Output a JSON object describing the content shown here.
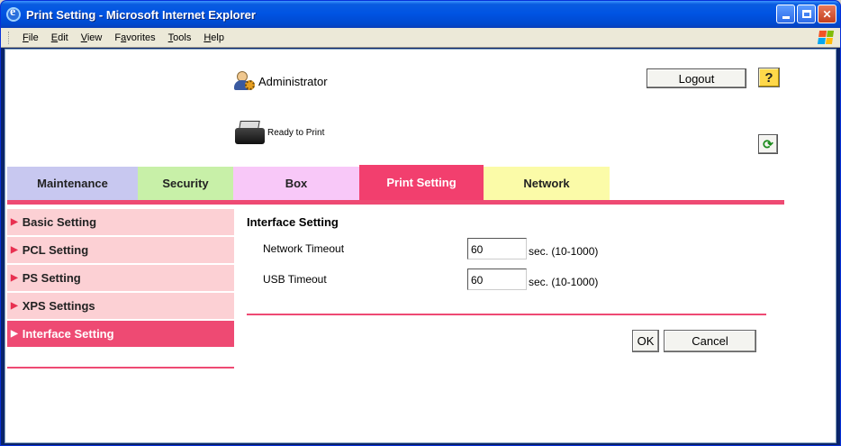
{
  "window": {
    "title": "Print Setting - Microsoft Internet Explorer",
    "menu": [
      {
        "pre": "",
        "ul": "F",
        "post": "ile"
      },
      {
        "pre": "",
        "ul": "E",
        "post": "dit"
      },
      {
        "pre": "",
        "ul": "V",
        "post": "iew"
      },
      {
        "pre": "F",
        "ul": "a",
        "post": "vorites"
      },
      {
        "pre": "",
        "ul": "T",
        "post": "ools"
      },
      {
        "pre": "",
        "ul": "H",
        "post": "elp"
      }
    ]
  },
  "header": {
    "user_label": "Administrator",
    "logout_label": "Logout",
    "help_label": "?",
    "status_label": "Ready to Print"
  },
  "tabs": [
    {
      "label": "Maintenance"
    },
    {
      "label": "Security"
    },
    {
      "label": "Box"
    },
    {
      "label": "Print Setting"
    },
    {
      "label": "Network"
    }
  ],
  "sidebar": {
    "items": [
      {
        "label": "Basic Setting"
      },
      {
        "label": "PCL Setting"
      },
      {
        "label": "PS Setting"
      },
      {
        "label": "XPS Settings"
      },
      {
        "label": "Interface Setting"
      }
    ]
  },
  "main": {
    "title": "Interface Setting",
    "fields": [
      {
        "label": "Network Timeout",
        "value": "60",
        "unit": "sec. (10-1000)"
      },
      {
        "label": "USB Timeout",
        "value": "60",
        "unit": "sec. (10-1000)"
      }
    ],
    "ok_label": "OK",
    "cancel_label": "Cancel"
  },
  "colors": {
    "accent": "#ee4a73",
    "sidebar_bg": "#fcd0d4",
    "tab_maintenance": "#c8c8f0",
    "tab_security": "#c8f0a8",
    "tab_box": "#f8c8f8",
    "tab_print": "#f23f6e",
    "tab_network": "#fbfba8"
  }
}
